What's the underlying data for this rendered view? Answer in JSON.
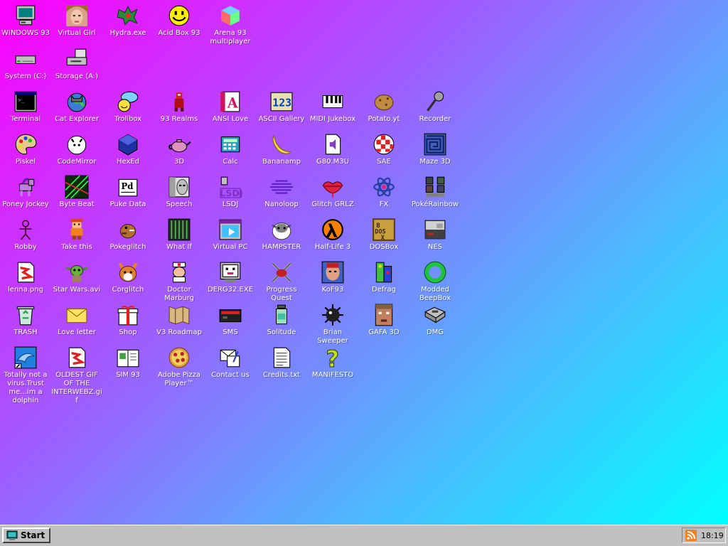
{
  "desktop": {
    "icons": [
      {
        "label": "WINDOWS 93",
        "icon": "computer-icon"
      },
      {
        "label": "Virtual Girl",
        "icon": "face-icon"
      },
      {
        "label": "Hydra.exe",
        "icon": "dragon-icon"
      },
      {
        "label": "Acid Box 93",
        "icon": "smiley-icon"
      },
      {
        "label": "Arena 93 multiplayer",
        "icon": "cube-icon"
      },
      {
        "label": "System (C:)",
        "icon": "drive-icon"
      },
      {
        "label": "Storage (A:)",
        "icon": "floppy-drive-icon"
      },
      {
        "label": "Terminal",
        "icon": "terminal-icon"
      },
      {
        "label": "Cat Explorer",
        "icon": "cat-globe-icon"
      },
      {
        "label": "Trollbox",
        "icon": "chat-icon"
      },
      {
        "label": "93 Realms",
        "icon": "knight-icon"
      },
      {
        "label": "ANSI Love",
        "icon": "ansi-icon"
      },
      {
        "label": "ASCII Gallery",
        "icon": "ascii-icon"
      },
      {
        "label": "MIDI Jukebox",
        "icon": "piano-icon"
      },
      {
        "label": "Potato.yt",
        "icon": "potato-icon"
      },
      {
        "label": "Recorder",
        "icon": "microphone-icon"
      },
      {
        "label": "Piskel",
        "icon": "palette-icon"
      },
      {
        "label": "CodeMirror",
        "icon": "code-cat-icon"
      },
      {
        "label": "HexEd",
        "icon": "hex-cube-icon"
      },
      {
        "label": "3D",
        "icon": "teapot-icon"
      },
      {
        "label": "Calc",
        "icon": "calculator-icon"
      },
      {
        "label": "Bananamp",
        "icon": "banana-icon"
      },
      {
        "label": "G80.M3U",
        "icon": "playlist-icon"
      },
      {
        "label": "SAE",
        "icon": "ball-icon"
      },
      {
        "label": "Maze 3D",
        "icon": "maze-icon"
      },
      {
        "label": "Poney Jockey",
        "icon": "pony-icon"
      },
      {
        "label": "Byte Beat",
        "icon": "bytebeat-icon"
      },
      {
        "label": "Puke Data",
        "icon": "pd-icon"
      },
      {
        "label": "Speech",
        "icon": "speech-face-icon"
      },
      {
        "label": "LSDJ",
        "icon": "lsdj-icon"
      },
      {
        "label": "Nanoloop",
        "icon": "wave-icon"
      },
      {
        "label": "Glitch GRLZ",
        "icon": "lips-icon"
      },
      {
        "label": "FX",
        "icon": "atom-icon"
      },
      {
        "label": "PokéRainbow",
        "icon": "trainers-icon"
      },
      {
        "label": "Robby",
        "icon": "stickman-icon"
      },
      {
        "label": "Take this",
        "icon": "pixel-man-icon"
      },
      {
        "label": "Pokeglitch",
        "icon": "pokeglitch-icon"
      },
      {
        "label": "What If",
        "icon": "whatif-icon"
      },
      {
        "label": "Virtual PC",
        "icon": "window-icon"
      },
      {
        "label": "HAMPSTER",
        "icon": "hamster-icon"
      },
      {
        "label": "Half-Life 3",
        "icon": "lambda-icon"
      },
      {
        "label": "DOSBox",
        "icon": "dosbox-icon"
      },
      {
        "label": "NES",
        "icon": "nes-icon"
      },
      {
        "label": "lenna.png",
        "icon": "image-file-icon"
      },
      {
        "label": "Star Wars.avi",
        "icon": "yoda-icon"
      },
      {
        "label": "Corglitch",
        "icon": "corgi-icon"
      },
      {
        "label": "Doctor Marburg",
        "icon": "doctor-icon"
      },
      {
        "label": "DERG32.EXE",
        "icon": "derg-icon"
      },
      {
        "label": "Progress Quest",
        "icon": "swords-icon"
      },
      {
        "label": "KoF93",
        "icon": "fighter-icon"
      },
      {
        "label": "Defrag",
        "icon": "defrag-icon"
      },
      {
        "label": "Modded BeepBox",
        "icon": "ring-icon"
      },
      {
        "label": "TRASH",
        "icon": "recycle-bin-icon"
      },
      {
        "label": "Love letter",
        "icon": "envelope-icon"
      },
      {
        "label": "Shop",
        "icon": "gift-icon"
      },
      {
        "label": "V3 Roadmap",
        "icon": "map-icon"
      },
      {
        "label": "SMS",
        "icon": "sms-console-icon"
      },
      {
        "label": "Solitude",
        "icon": "jar-icon"
      },
      {
        "label": "Brian Sweeper",
        "icon": "mine-icon"
      },
      {
        "label": "GAFA 3D",
        "icon": "doomguy-icon"
      },
      {
        "label": "DMG",
        "icon": "cartridge-icon"
      },
      {
        "label": "Totally not a virus.Trust me...im a dolphin",
        "icon": "dolphin-icon"
      },
      {
        "label": "OLDEST GIF OF THE INTERWEBZ.gif",
        "icon": "image-file-icon"
      },
      {
        "label": "SIM 93",
        "icon": "sim-book-icon"
      },
      {
        "label": "Adobe Pizza Player™",
        "icon": "pizza-icon"
      },
      {
        "label": "Contact us",
        "icon": "contact-icon"
      },
      {
        "label": "Credits.txt",
        "icon": "text-file-icon"
      },
      {
        "label": "MANIFESTO",
        "icon": "question-icon"
      }
    ]
  },
  "taskbar": {
    "start_label": "Start",
    "clock": "18:19"
  },
  "colors": {
    "gradient_start": "#ff00ff",
    "gradient_end": "#00ffff",
    "taskbar_gray": "#c0c0c0"
  }
}
